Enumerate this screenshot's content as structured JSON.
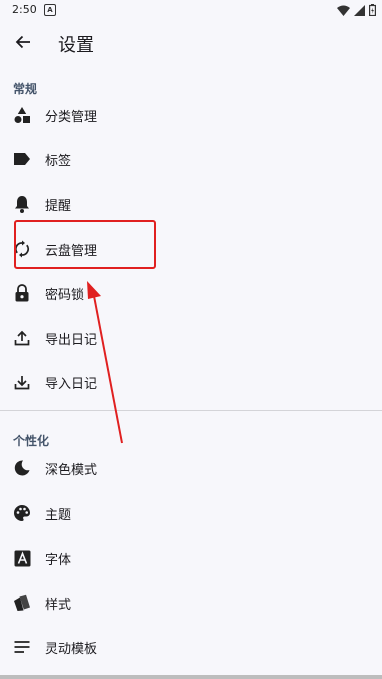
{
  "status_bar": {
    "time": "2:50",
    "notification_letter": "A"
  },
  "app_bar": {
    "title": "设置"
  },
  "sections": [
    {
      "header": "常规",
      "items": [
        {
          "label": "分类管理",
          "icon": "category-icon"
        },
        {
          "label": "标签",
          "icon": "label-icon"
        },
        {
          "label": "提醒",
          "icon": "bell-icon"
        },
        {
          "label": "云盘管理",
          "icon": "sync-icon"
        },
        {
          "label": "密码锁",
          "icon": "lock-icon"
        },
        {
          "label": "导出日记",
          "icon": "upload-icon"
        },
        {
          "label": "导入日记",
          "icon": "download-icon"
        }
      ]
    },
    {
      "header": "个性化",
      "items": [
        {
          "label": "深色模式",
          "icon": "moon-icon"
        },
        {
          "label": "主题",
          "icon": "palette-icon"
        },
        {
          "label": "字体",
          "icon": "font-icon"
        },
        {
          "label": "样式",
          "icon": "style-icon"
        },
        {
          "label": "灵动模板",
          "icon": "template-icon"
        }
      ]
    }
  ],
  "annotation": {
    "highlight_color": "#e02020",
    "highlighted_item": "云盘管理"
  }
}
